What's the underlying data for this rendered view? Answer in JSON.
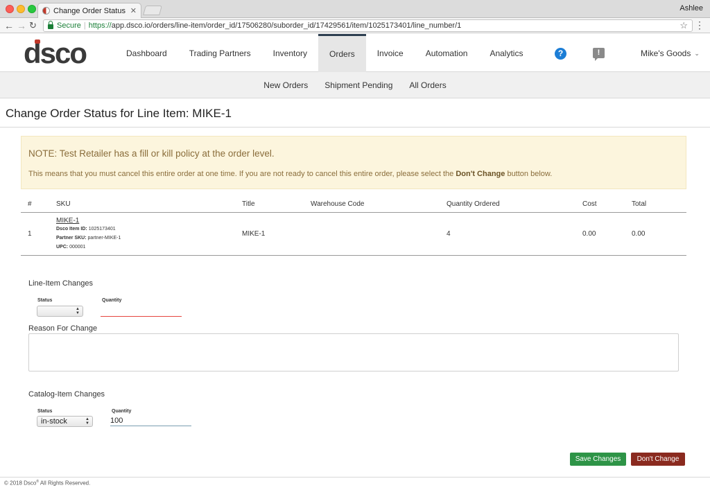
{
  "browser": {
    "tab_title": "Change Order Status for Line I",
    "profile": "Ashlee",
    "secure_label": "Secure",
    "url_scheme": "https://",
    "url_rest": "app.dsco.io/orders/line-item/order_id/17506280/suborder_id/17429561/item/1025173401/line_number/1",
    "icons": [
      "back-arrow-icon",
      "forward-arrow-icon",
      "reload-icon",
      "lock-icon",
      "star-icon",
      "menu-dots-icon"
    ]
  },
  "header": {
    "logo": "dsco",
    "nav": [
      {
        "label": "Dashboard"
      },
      {
        "label": "Trading Partners"
      },
      {
        "label": "Inventory"
      },
      {
        "label": "Orders",
        "active": true
      },
      {
        "label": "Invoice"
      },
      {
        "label": "Automation"
      },
      {
        "label": "Analytics"
      }
    ],
    "help_glyph": "?",
    "feedback_glyph": "!",
    "account": "Mike's Goods",
    "accent_color": "#1c7ed6"
  },
  "subnav": [
    {
      "label": "New Orders"
    },
    {
      "label": "Shipment Pending"
    },
    {
      "label": "All Orders"
    }
  ],
  "page": {
    "title": "Change Order Status for Line Item: MIKE-1"
  },
  "notice": {
    "heading": "NOTE: Test Retailer has a fill or kill policy at the order level.",
    "body_before": "This means that you must cancel this entire order at one time. If you are not ready to cancel this entire order, please select the ",
    "body_bold": "Don't Change",
    "body_after": " button below.",
    "bg_color": "#fcf5dd",
    "text_color": "#8a6d3b"
  },
  "table": {
    "columns": [
      "#",
      "SKU",
      "Title",
      "Warehouse Code",
      "Quantity Ordered",
      "Cost",
      "Total"
    ],
    "rows": [
      {
        "number": "1",
        "sku": "MIKE-1",
        "item_id_label": "Dsco Item ID:",
        "item_id": "1025173401",
        "partner_sku_label": "Partner SKU:",
        "partner_sku": "partner-MIKE-1",
        "upc_label": "UPC:",
        "upc": "000001",
        "title": "MIKE-1",
        "warehouse_code": "",
        "quantity_ordered": "4",
        "cost": "0.00",
        "total": "0.00"
      }
    ]
  },
  "line_item_changes": {
    "heading": "Line-Item Changes",
    "status_label": "Status",
    "status_value": "",
    "quantity_label": "Quantity",
    "quantity_value": "",
    "reason_label": "Reason For Change",
    "reason_value": ""
  },
  "catalog_item_changes": {
    "heading": "Catalog-Item Changes",
    "status_label": "Status",
    "status_value": "in-stock",
    "quantity_label": "Quantity",
    "quantity_value": "100"
  },
  "buttons": {
    "save": "Save Changes",
    "dont_change": "Don't Change",
    "save_color": "#2e9447",
    "dont_color": "#8a2a1f"
  },
  "footer": {
    "copyright_before": "© 2018 Dsco",
    "reg_mark": "®",
    "copyright_after": " All Rights Reserved."
  }
}
